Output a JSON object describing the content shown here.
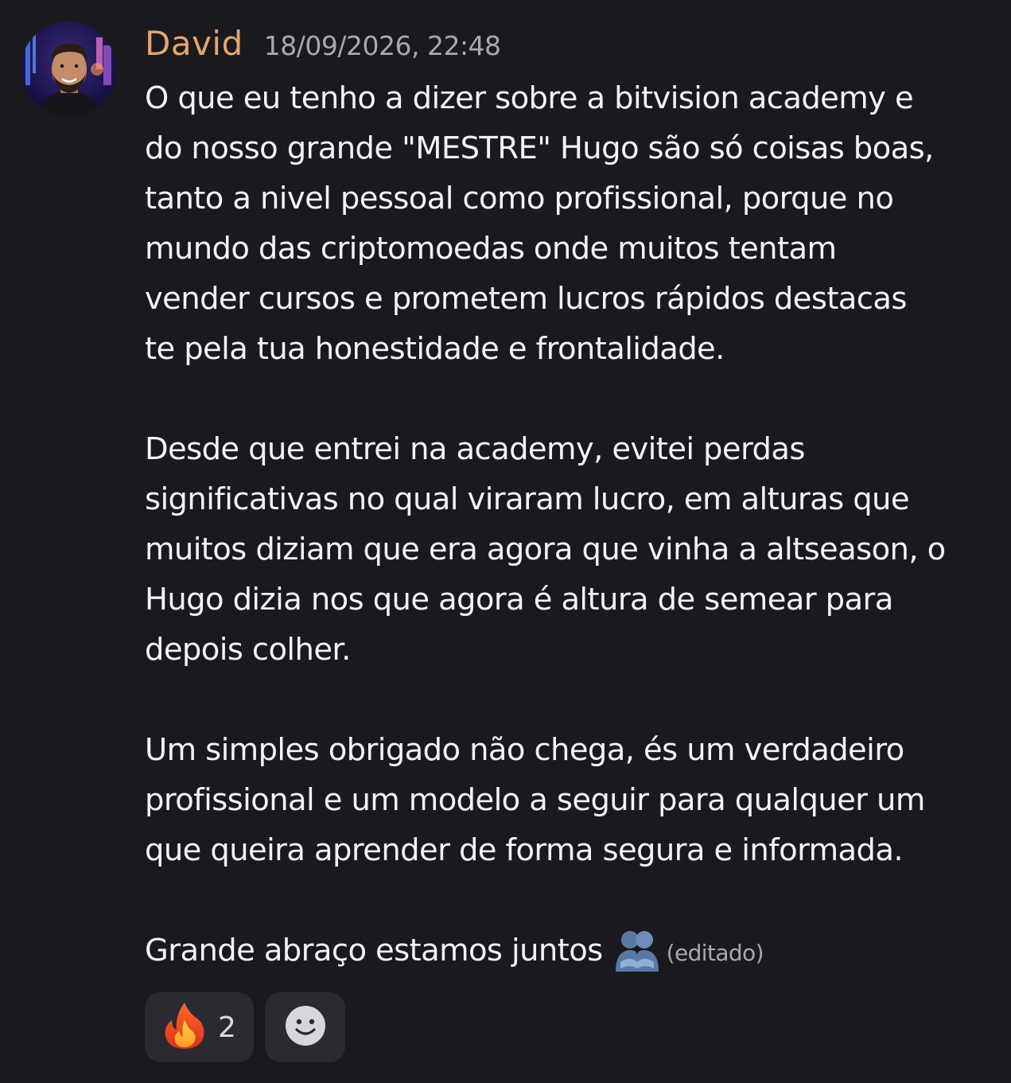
{
  "message": {
    "author": "David",
    "timestamp": "18/09/2026, 22:48",
    "paragraphs": [
      [
        "O que eu tenho a dizer sobre a bitvision academy e",
        "do nosso grande \"MESTRE\" Hugo são só coisas boas,",
        "tanto a nivel pessoal como profissional, porque no",
        "mundo das criptomoedas onde muitos tentam",
        "vender cursos e prometem lucros rápidos destacas",
        "te pela tua honestidade e frontalidade."
      ],
      [
        "Desde que entrei na academy, evitei perdas",
        "significativas no qual viraram lucro, em alturas que",
        "muitos diziam que era agora que vinha a altseason, o",
        "Hugo dizia nos que agora é altura de semear para",
        "depois colher."
      ],
      [
        "Um simples obrigado não chega, és um verdadeiro",
        "profissional e um modelo a seguir para qualquer um",
        "que queira aprender de forma segura e informada."
      ]
    ],
    "last_line": "Grande abraço estamos juntos",
    "last_line_icon": "people-hugging-icon",
    "edited_label": "(editado)"
  },
  "reactions": [
    {
      "icon": "fire-emoji-icon",
      "count": "2"
    },
    {
      "icon": "add-reaction-smiley-icon"
    }
  ],
  "colors": {
    "background": "#1a1a1e",
    "username": "#e5a570",
    "text": "#f2f3f5",
    "muted": "#a8a9b0",
    "reaction_bg": "#2a2b30"
  }
}
